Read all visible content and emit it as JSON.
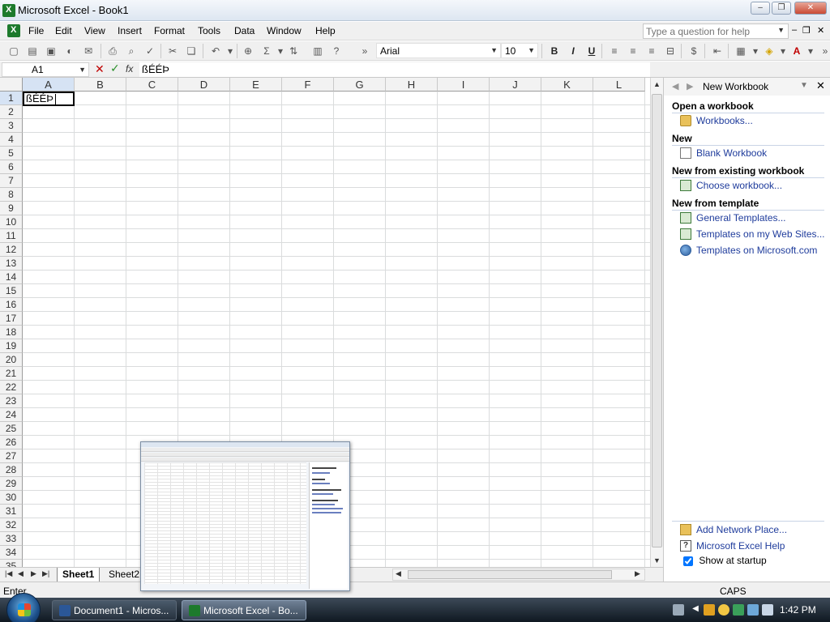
{
  "window": {
    "title": "Microsoft Excel - Book1",
    "minimize": "–",
    "maximize": "❐",
    "close": "✕"
  },
  "menu": {
    "items": [
      "File",
      "Edit",
      "View",
      "Insert",
      "Format",
      "Tools",
      "Data",
      "Window",
      "Help"
    ],
    "help_placeholder": "Type a question for help",
    "doc_min": "–",
    "doc_restore": "❐",
    "doc_close": "✕"
  },
  "toolbar": {
    "font_name": "Arial",
    "font_size": "10",
    "overflow": "»"
  },
  "formula_bar": {
    "name_box": "A1",
    "cancel": "✕",
    "enter": "✓",
    "fx": "fx",
    "content": "ßÉÉÞ"
  },
  "grid": {
    "columns": [
      "A",
      "B",
      "C",
      "D",
      "E",
      "F",
      "G",
      "H",
      "I",
      "J",
      "K",
      "L"
    ],
    "rows": [
      "1",
      "2",
      "3",
      "4",
      "5",
      "6",
      "7",
      "8",
      "9",
      "10",
      "11",
      "12",
      "13",
      "14",
      "15",
      "16",
      "17",
      "18",
      "19",
      "20",
      "21",
      "22",
      "23",
      "24",
      "25",
      "26",
      "27",
      "28",
      "29",
      "30",
      "31",
      "32",
      "33",
      "34",
      "35"
    ],
    "active_cell_value": "ßÉÉÞ"
  },
  "sheet_tabs": [
    "Sheet1",
    "Sheet2"
  ],
  "task_pane": {
    "title": "New Workbook",
    "sections": [
      {
        "heading": "Open a workbook",
        "links": [
          {
            "label": "Workbooks...",
            "icon": "folder-icon"
          }
        ]
      },
      {
        "heading": "New",
        "links": [
          {
            "label": "Blank Workbook",
            "icon": "blank-doc-icon"
          }
        ]
      },
      {
        "heading": "New from existing workbook",
        "links": [
          {
            "label": "Choose workbook...",
            "icon": "workbook-icon"
          }
        ]
      },
      {
        "heading": "New from template",
        "links": [
          {
            "label": "General Templates...",
            "icon": "template-icon"
          },
          {
            "label": "Templates on my Web Sites...",
            "icon": "web-template-icon"
          },
          {
            "label": "Templates on Microsoft.com",
            "icon": "globe-icon"
          }
        ]
      }
    ],
    "footer_links": [
      {
        "label": "Add Network Place...",
        "icon": "network-place-icon"
      },
      {
        "label": "Microsoft Excel Help",
        "icon": "help-icon"
      }
    ],
    "show_at_startup": "Show at startup"
  },
  "status_bar": {
    "mode": "Enter",
    "caps": "CAPS"
  },
  "taskbar": {
    "buttons": [
      {
        "label": "Document1 - Micros...",
        "active": false
      },
      {
        "label": "Microsoft Excel - Bo...",
        "active": true
      }
    ],
    "clock": "1:42 PM"
  }
}
